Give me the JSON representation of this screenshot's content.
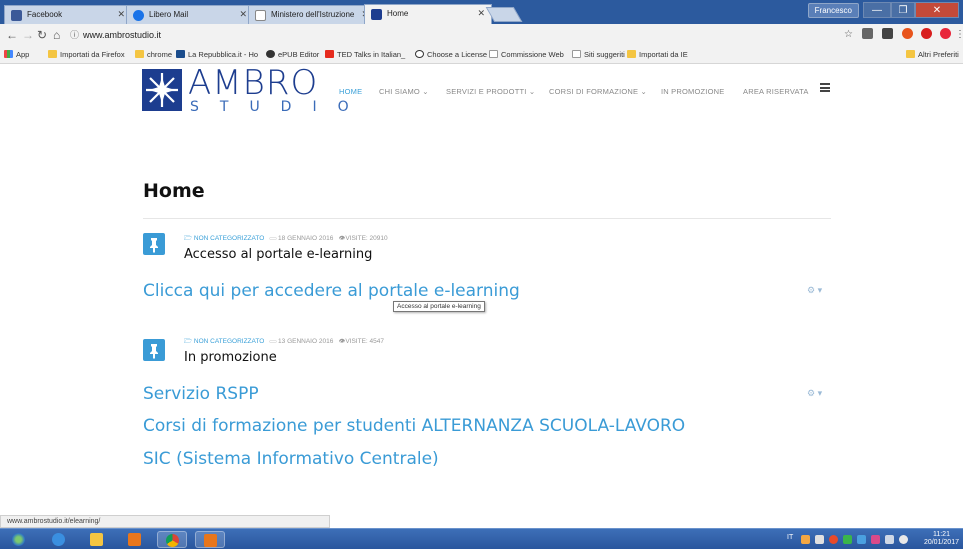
{
  "browser": {
    "tabs": [
      {
        "title": "Facebook",
        "color": "#3b5998"
      },
      {
        "title": "Libero Mail",
        "color": "#1a73e8"
      },
      {
        "title": "Ministero dell'Istruzione",
        "color": "#888888"
      },
      {
        "title": "Home",
        "color": "#1d3d8f"
      }
    ],
    "profile": "Francesco",
    "url": "www.ambrostudio.it",
    "bookmarks": [
      {
        "label": "App",
        "icon": "apps-icon"
      },
      {
        "label": "Importati da Firefox",
        "icon": "folder-icon"
      },
      {
        "label": "chrome",
        "icon": "folder-icon"
      },
      {
        "label": "La Repubblica.it - Ho",
        "icon": "repubblica-icon"
      },
      {
        "label": "ePUB Editor",
        "icon": "epub-icon"
      },
      {
        "label": "TED Talks in Italian_",
        "icon": "ted-icon"
      },
      {
        "label": "Choose a License",
        "icon": "cc-icon"
      },
      {
        "label": "Commissione Web",
        "icon": "page-icon"
      },
      {
        "label": "Siti suggeriti",
        "icon": "page-icon"
      },
      {
        "label": "Importati da IE",
        "icon": "folder-icon"
      },
      {
        "label": "Altri Preferiti",
        "icon": "folder-icon"
      }
    ]
  },
  "site": {
    "logo_text": "AMBRO",
    "logo_sub": "STUDIO",
    "nav": [
      "HOME",
      "CHI SIAMO ⌄",
      "SERVIZI E PRODOTTI ⌄",
      "CORSI DI FORMAZIONE ⌄",
      "IN PROMOZIONE",
      "AREA RISERVATA"
    ],
    "page_title": "Home",
    "posts": [
      {
        "category": "NON CATEGORIZZATO",
        "date": "18 GENNAIO 2016",
        "visits": "VISITE: 20910",
        "title": "Accesso al portale e-learning",
        "links": [
          "Clicca qui per accedere al portale e-learning"
        ]
      },
      {
        "category": "NON CATEGORIZZATO",
        "date": "13 GENNAIO 2016",
        "visits": "VISITE: 4547",
        "title": "In promozione",
        "links": [
          "Servizio RSPP",
          "Corsi di formazione per studenti ALTERNANZA SCUOLA-LAVORO",
          "SIC (Sistema Informativo Centrale)"
        ]
      }
    ],
    "tooltip": "Accesso al portale e-learning",
    "status_url": "www.ambrostudio.it/elearning/",
    "gear_label": "⚙ ▾"
  },
  "taskbar": {
    "lang": "IT",
    "time": "11:21",
    "date": "20/01/2017"
  },
  "colors": {
    "accent": "#3a9bd6",
    "brand": "#1d3d8f"
  }
}
